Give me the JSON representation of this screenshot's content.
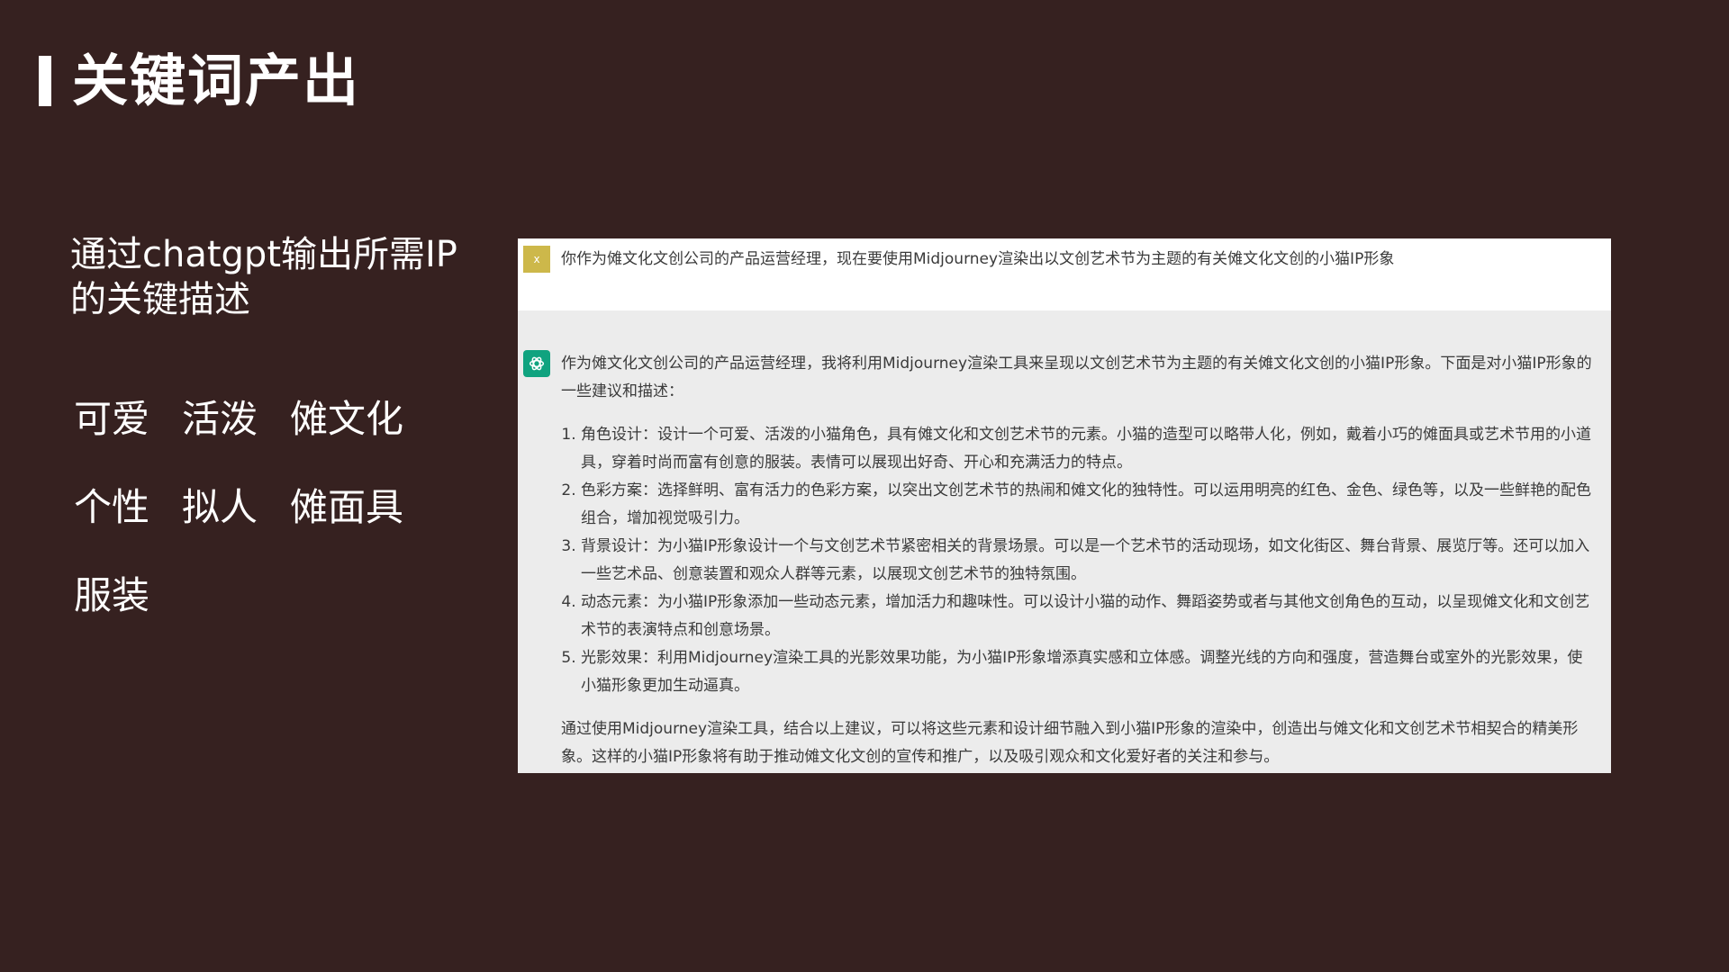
{
  "header": {
    "title": "关键词产出"
  },
  "left": {
    "subtitle": "通过chatgpt输出所需IP的关键描述",
    "keywords": [
      "可爱",
      "活泼",
      "傩文化",
      "个性",
      "拟人",
      "傩面具",
      "服装"
    ]
  },
  "chat": {
    "user": {
      "avatar_letter": "x",
      "message": "你作为傩文化文创公司的产品运营经理，现在要使用Midjourney渲染出以文创艺术节为主题的有关傩文化文创的小猫IP形象"
    },
    "assistant": {
      "intro": "作为傩文化文创公司的产品运营经理，我将利用Midjourney渲染工具来呈现以文创艺术节为主题的有关傩文化文创的小猫IP形象。下面是对小猫IP形象的一些建议和描述：",
      "items": [
        "角色设计：设计一个可爱、活泼的小猫角色，具有傩文化和文创艺术节的元素。小猫的造型可以略带人化，例如，戴着小巧的傩面具或艺术节用的小道具，穿着时尚而富有创意的服装。表情可以展现出好奇、开心和充满活力的特点。",
        "色彩方案：选择鲜明、富有活力的色彩方案，以突出文创艺术节的热闹和傩文化的独特性。可以运用明亮的红色、金色、绿色等，以及一些鲜艳的配色组合，增加视觉吸引力。",
        "背景设计：为小猫IP形象设计一个与文创艺术节紧密相关的背景场景。可以是一个艺术节的活动现场，如文化街区、舞台背景、展览厅等。还可以加入一些艺术品、创意装置和观众人群等元素，以展现文创艺术节的独特氛围。",
        "动态元素：为小猫IP形象添加一些动态元素，增加活力和趣味性。可以设计小猫的动作、舞蹈姿势或者与其他文创角色的互动，以呈现傩文化和文创艺术节的表演特点和创意场景。",
        "光影效果：利用Midjourney渲染工具的光影效果功能，为小猫IP形象增添真实感和立体感。调整光线的方向和强度，营造舞台或室外的光影效果，使小猫形象更加生动逼真。"
      ],
      "outro": "通过使用Midjourney渲染工具，结合以上建议，可以将这些元素和设计细节融入到小猫IP形象的渲染中，创造出与傩文化和文创艺术节相契合的精美形象。这样的小猫IP形象将有助于推动傩文化文创的宣传和推广，以及吸引观众和文化爱好者的关注和参与。"
    }
  }
}
